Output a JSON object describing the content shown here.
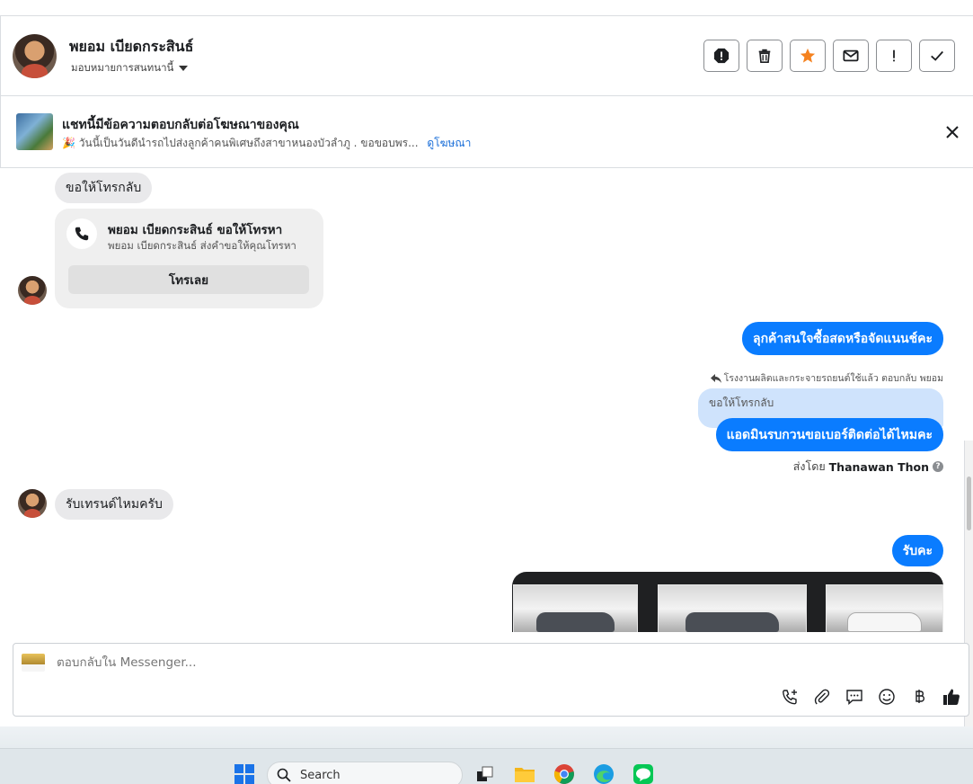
{
  "header": {
    "contact_name": "พยอม เบียดกระสินธ์",
    "assign_label": "มอบหมายการสนทนานี้",
    "actions": [
      "spam-icon",
      "trash-icon",
      "star-icon",
      "mail-icon",
      "exclaim-icon",
      "check-icon"
    ],
    "accent_star": "#f5821f"
  },
  "ad_banner": {
    "title": "แชทนี้มีข้อความตอบกลับต่อโฆษณาของคุณ",
    "subtitle": "🎉 วันนี้เป็นวันดีนำรถไปส่งลูกค้าคนพิเศษถึงสาขาหนองบัวลำภู . ขอขอบพร...",
    "link": "ดูโฆษณา"
  },
  "messages": {
    "in_1": "ขอให้โทรกลับ",
    "call_card": {
      "title": "พยอม เบียดกระสินธ์ ขอให้โทรหา",
      "subtitle": "พยอม เบียดกระสินธ์ ส่งคำขอให้คุณโทรหา",
      "button": "โทรเลย"
    },
    "out_1": "ลุกค้าสนใจซื้อสดหรือจัดแนนช์คะ",
    "reply_note": "โรงงานผลิตและกระจายรถยนต์ใช้แล้ว ตอบกลับ พยอม",
    "quoted": "ขอให้โทรกลับ",
    "out_2": "แอดมินรบกวนขอเบอร์ติดต่อได้ไหมคะ",
    "sent_by_prefix": "ส่งโดย",
    "sent_by_name": "Thanawan Thon",
    "help": "?",
    "in_2": "รับเทรนด์ไหมครับ",
    "out_3": "รับคะ",
    "out_bubble_color": "#0a7cff"
  },
  "composer": {
    "placeholder": "ตอบกลับใน Messenger..."
  },
  "taskbar": {
    "search_label": "Search"
  }
}
